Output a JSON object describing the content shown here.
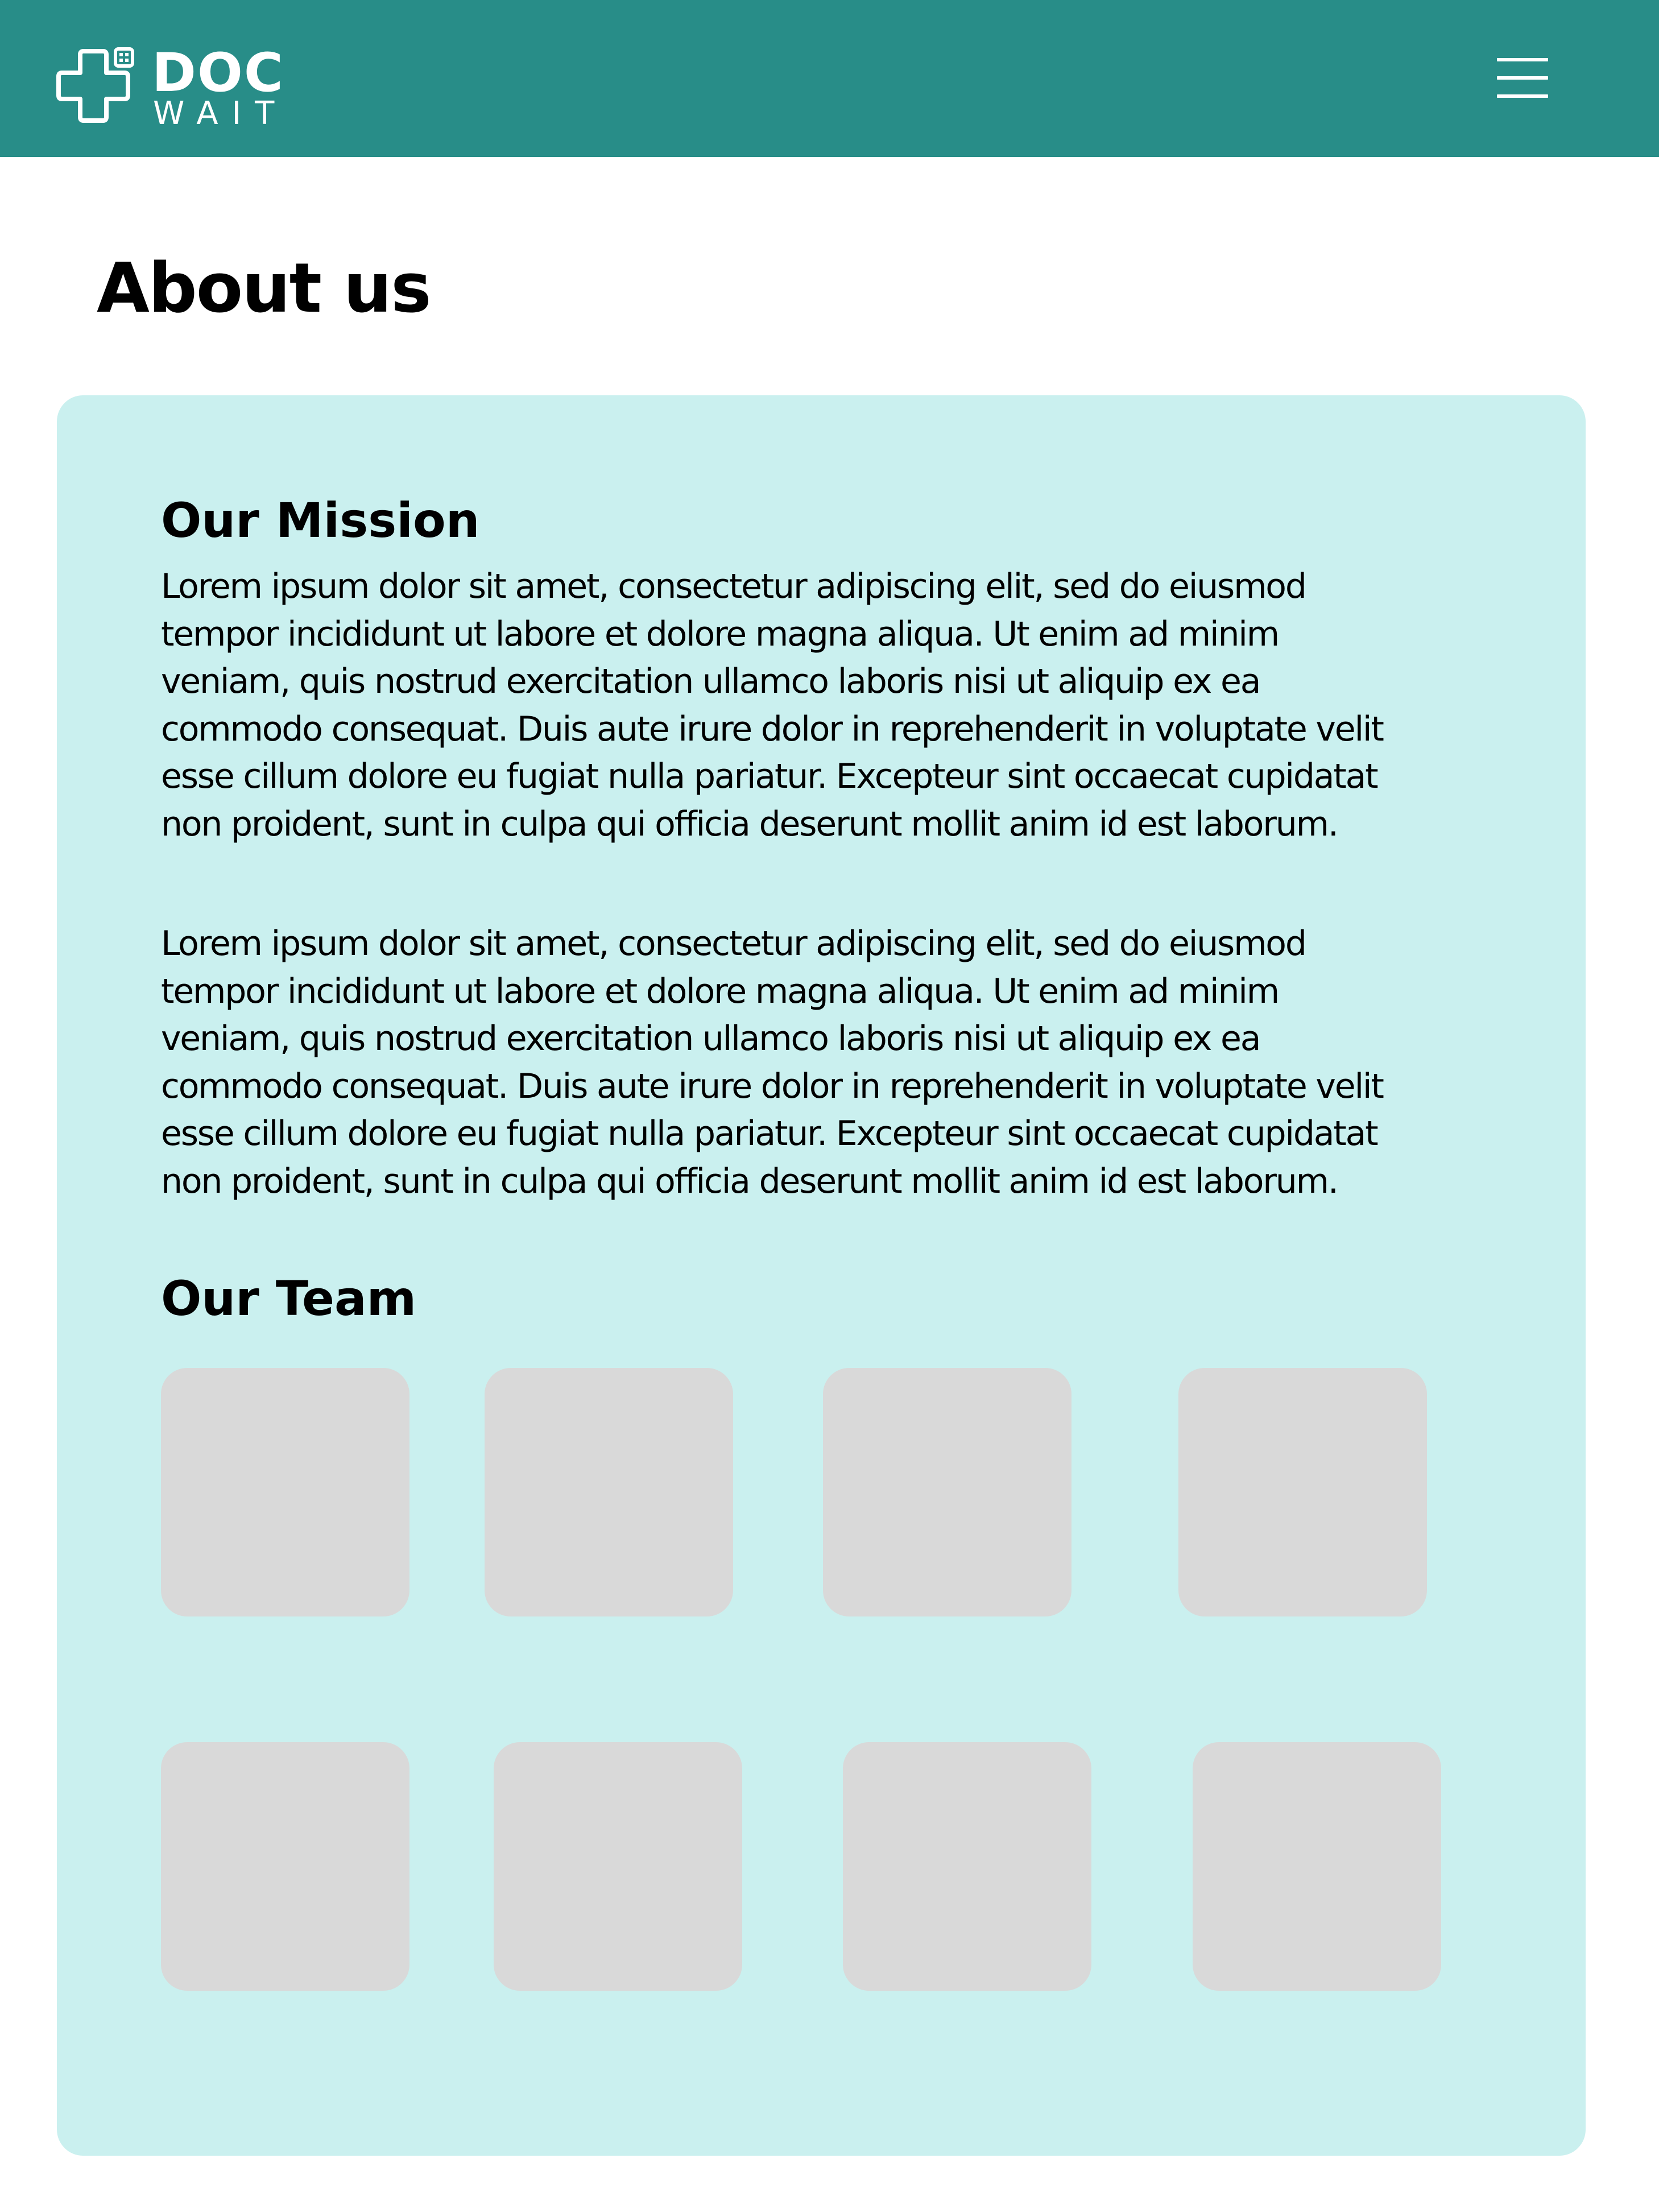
{
  "header": {
    "logo": {
      "line1": "DOC",
      "line2": "WAIT"
    },
    "menu_icon": "hamburger-menu-icon"
  },
  "page": {
    "title": "About us"
  },
  "mission": {
    "heading": "Our Mission",
    "paragraphs": [
      "Lorem ipsum dolor sit amet, consectetur adipiscing elit, sed do eiusmod tempor incididunt ut labore et dolore magna aliqua. Ut enim ad minim veniam, quis nostrud exercitation ullamco laboris nisi ut aliquip ex ea commodo consequat. Duis aute irure dolor in reprehenderit in voluptate velit esse cillum dolore eu fugiat nulla pariatur. Excepteur sint occaecat cupidatat non proident, sunt in culpa qui officia deserunt mollit anim id est laborum.",
      "Lorem ipsum dolor sit amet, consectetur adipiscing elit, sed do eiusmod tempor incididunt ut labore et dolore magna aliqua. Ut enim ad minim veniam, quis nostrud exercitation ullamco laboris nisi ut aliquip ex ea commodo consequat. Duis aute irure dolor in reprehenderit in voluptate velit esse cillum dolore eu fugiat nulla pariatur. Excepteur sint occaecat cupidatat non proident, sunt in culpa qui officia deserunt mollit anim id est laborum."
    ]
  },
  "team": {
    "heading": "Our Team",
    "member_count": 8
  },
  "colors": {
    "header": "#288d88",
    "card": "#caf0ef",
    "placeholder": "#d9d9d9",
    "text": "#000000",
    "header_text": "#ffffff"
  }
}
